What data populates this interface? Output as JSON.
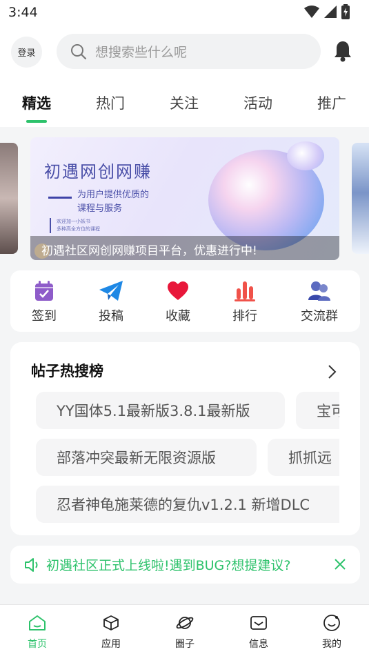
{
  "status_bar": {
    "time": "3:44"
  },
  "header": {
    "login_label": "登录",
    "search_placeholder": "想搜索些什么呢",
    "tabs": [
      {
        "label": "精选",
        "active": true
      },
      {
        "label": "热门",
        "active": false
      },
      {
        "label": "关注",
        "active": false
      },
      {
        "label": "活动",
        "active": false
      },
      {
        "label": "推广",
        "active": false
      }
    ]
  },
  "banner": {
    "title": "初遇网创网赚",
    "subtitle_line1": "为用户提供优质的",
    "subtitle_line2": "课程与服务",
    "tiny_line1": "欢迎加一小妖书",
    "tiny_line2": "多种高全方位的课程",
    "caption": "初遇社区网创网赚项目平台，优惠进行中!"
  },
  "quick_actions": [
    {
      "label": "签到",
      "icon": "calendar-check-icon"
    },
    {
      "label": "投稿",
      "icon": "paper-plane-icon"
    },
    {
      "label": "收藏",
      "icon": "heart-icon"
    },
    {
      "label": "排行",
      "icon": "bar-chart-icon"
    },
    {
      "label": "交流群",
      "icon": "group-icon"
    }
  ],
  "hot_search": {
    "title": "帖子热搜榜",
    "items": [
      "YY国体5.1最新版3.8.1最新版",
      "宝可",
      "部落冲突最新无限资源版",
      "抓抓远",
      "忍者神龟施莱德的复仇v1.2.1 新增DLC"
    ]
  },
  "notice": {
    "text": "初遇社区正式上线啦!遇到BUG?想提建议?"
  },
  "bottom_nav": [
    {
      "label": "首页",
      "icon": "home-icon",
      "active": true
    },
    {
      "label": "应用",
      "icon": "cube-icon",
      "active": false
    },
    {
      "label": "圈子",
      "icon": "planet-icon",
      "active": false
    },
    {
      "label": "信息",
      "icon": "mail-icon",
      "active": false
    },
    {
      "label": "我的",
      "icon": "profile-icon",
      "active": false
    }
  ],
  "colors": {
    "accent": "#2dc26b",
    "heart": "#e8173a",
    "plane": "#1e88e5",
    "chart": "#f0524a",
    "group": "#3f51b5",
    "calendar": "#8e5cc9"
  }
}
